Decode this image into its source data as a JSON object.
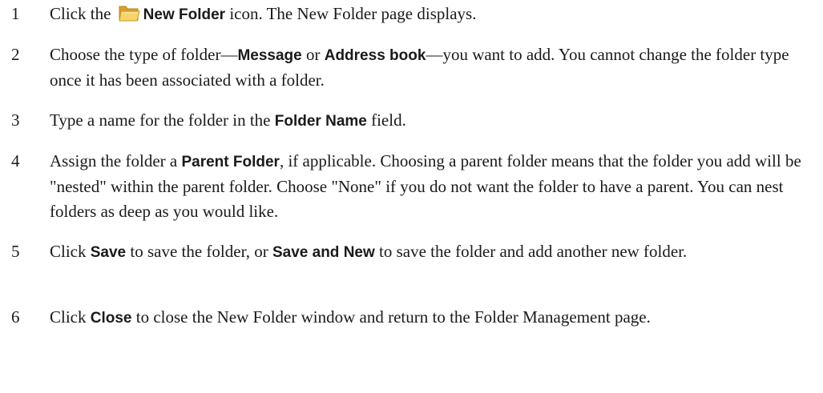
{
  "steps": [
    {
      "number": "1",
      "parts": [
        "Click the",
        "New Folder",
        "icon. The New Folder page displays."
      ]
    },
    {
      "number": "2",
      "parts": [
        "Choose the type of folder—",
        "Message",
        " or ",
        "Address book",
        "—you want to add. You cannot change the folder type once it has been associated with a folder."
      ]
    },
    {
      "number": "3",
      "parts": [
        "Type a name for the folder in the ",
        "Folder Name",
        " field."
      ]
    },
    {
      "number": "4",
      "parts": [
        "Assign the folder a ",
        "Parent Folder",
        ", if applicable. Choosing a parent folder means that the folder you add will be \"nested\" within the parent folder. Choose \"None\" if you do not want the folder to have a parent. You can nest folders as deep as you would like."
      ]
    },
    {
      "number": "5",
      "parts": [
        "Click ",
        "Save",
        " to save the folder, or ",
        "Save and New",
        " to save the folder and add another new folder."
      ]
    },
    {
      "number": "6",
      "parts": [
        "Click ",
        "Close",
        " to close the New Folder window and return to the Folder Management page."
      ]
    }
  ],
  "icons": {
    "new_folder_icon": "folder-icon"
  },
  "colors": {
    "text": "#1a1a1a",
    "folder_body": "#e8b43a",
    "folder_front": "#f7d46a"
  }
}
